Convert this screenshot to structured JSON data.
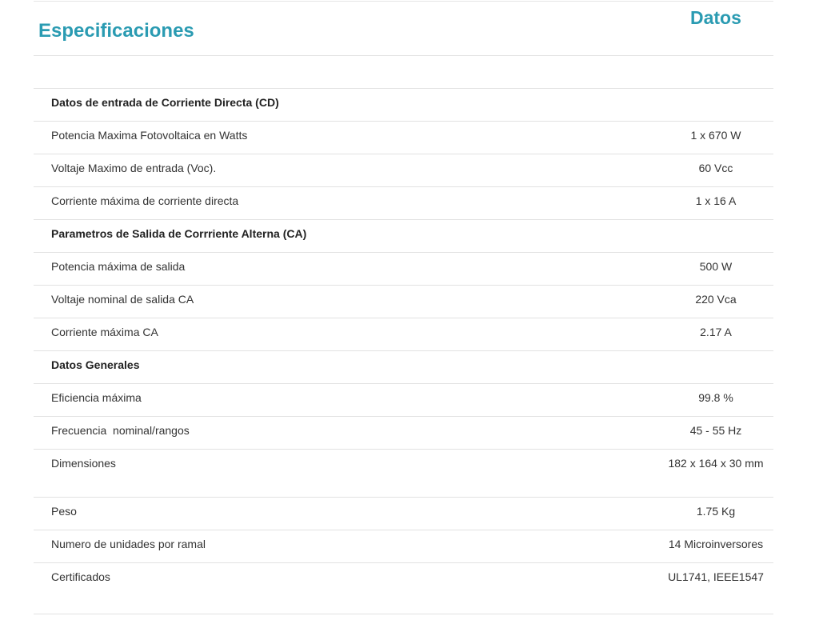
{
  "header": {
    "title": "Especificaciones",
    "column_title": "Datos"
  },
  "rows": [
    {
      "label": "Datos de entrada de Corriente Directa (CD)",
      "value": ""
    },
    {
      "label": "Potencia Maxima Fotovoltaica en Watts",
      "value": "1 x 670 W"
    },
    {
      "label": "Voltaje Maximo de entrada (Voc).",
      "value": "60 Vcc"
    },
    {
      "label": "Corriente máxima de corriente directa",
      "value": "1 x 16 A"
    },
    {
      "label": "Parametros de Salida de Corrriente Alterna (CA)",
      "value": ""
    },
    {
      "label": "Potencia máxima de salida",
      "value": "500 W"
    },
    {
      "label": "Voltaje nominal de salida CA",
      "value": "220 Vca"
    },
    {
      "label": "Corriente máxima CA",
      "value": "2.17 A"
    },
    {
      "label": "Datos Generales",
      "value": ""
    },
    {
      "label": "Eficiencia máxima",
      "value": "99.8 %"
    },
    {
      "label": "Frecuencia  nominal/rangos",
      "value": "45 - 55 Hz"
    },
    {
      "label": "Dimensiones",
      "value": "182 x 164 x 30 mm"
    },
    {
      "label": "Peso",
      "value": "1.75 Kg"
    },
    {
      "label": "Numero de unidades por ramal",
      "value": "14 Microinversores"
    },
    {
      "label": "Certificados",
      "value": "UL1741, IEEE1547"
    }
  ]
}
